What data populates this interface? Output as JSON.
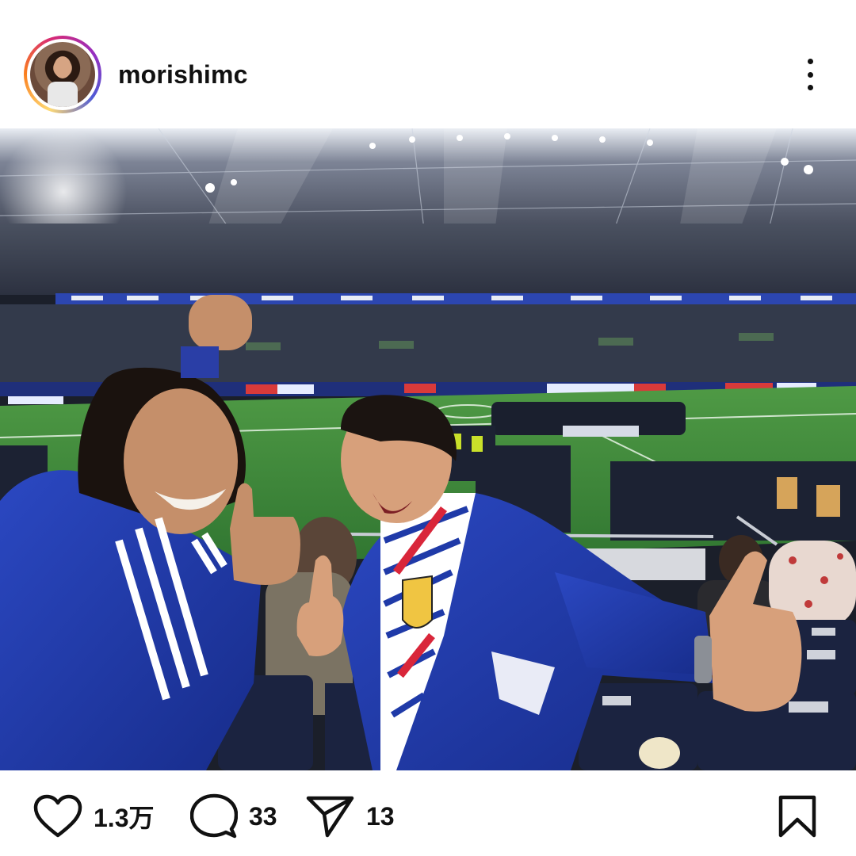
{
  "post": {
    "username": "morishimc",
    "avatar_icon": "profile-photo",
    "more_icon": "more-options-icon",
    "photo_description_icon": "stadium-photo"
  },
  "actions": {
    "likes": "1.3万",
    "comments": "33",
    "shares": "13",
    "like_icon": "heart-icon",
    "comment_icon": "comment-bubble-icon",
    "share_icon": "send-icon",
    "save_icon": "bookmark-icon"
  },
  "colors": {
    "ring_gradient": [
      "#feda75",
      "#fa7e1e",
      "#d62976",
      "#962fbf",
      "#4f5bd5"
    ],
    "jersey_blue": "#1f3aa8",
    "pitch_green": "#3f8a3a"
  }
}
